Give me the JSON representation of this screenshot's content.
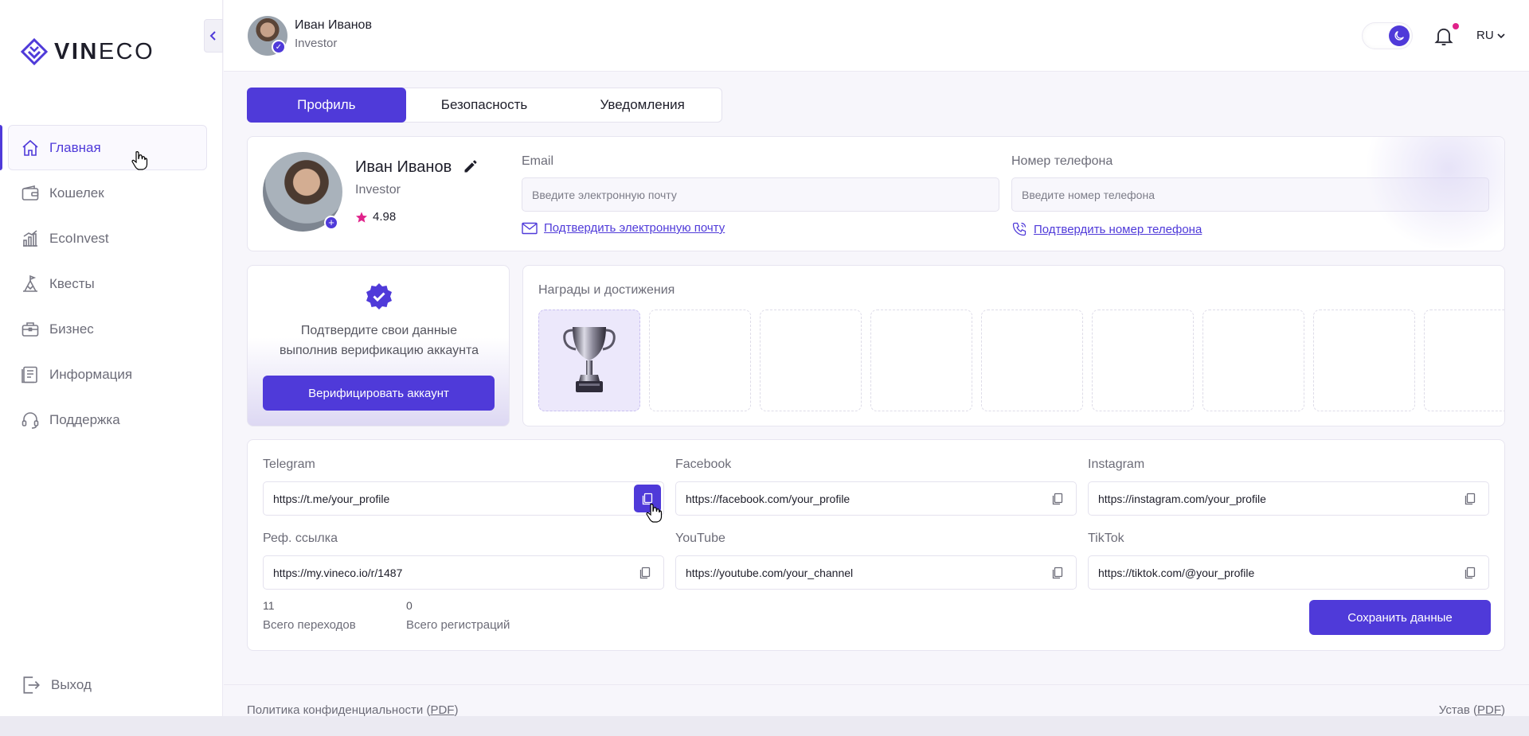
{
  "brand": {
    "logo_bold": "VIN",
    "logo_light": "ECO",
    "accent": "#4f3ad9"
  },
  "sidebar": {
    "items": [
      {
        "label": "Главная",
        "icon": "home-icon",
        "active": true
      },
      {
        "label": "Кошелек",
        "icon": "wallet-icon"
      },
      {
        "label": "EcoInvest",
        "icon": "chart-icon"
      },
      {
        "label": "Квесты",
        "icon": "quest-icon"
      },
      {
        "label": "Бизнес",
        "icon": "briefcase-icon"
      },
      {
        "label": "Информация",
        "icon": "document-icon"
      },
      {
        "label": "Поддержка",
        "icon": "headset-icon"
      }
    ],
    "logout": "Выход"
  },
  "header": {
    "user_name": "Иван Иванов",
    "user_role": "Investor",
    "lang": "RU"
  },
  "tabs": [
    "Профиль",
    "Безопасность",
    "Уведомления"
  ],
  "profile": {
    "name": "Иван Иванов",
    "role": "Investor",
    "rating": "4.98",
    "email_label": "Email",
    "email_placeholder": "Введите электронную почту",
    "email_verify": "Подтвердить электронную почту",
    "phone_label": "Номер телефона",
    "phone_placeholder": "Введите номер телефона",
    "phone_verify": "Подтвердить номер телефона"
  },
  "verify": {
    "line1": "Подтвердите свои данные",
    "line2": "выполнив верификацию аккаунта",
    "button": "Верифицировать аккаунт"
  },
  "awards": {
    "title": "Награды и достижения"
  },
  "social": {
    "telegram_label": "Telegram",
    "telegram": "https://t.me/your_profile",
    "facebook_label": "Facebook",
    "facebook": "https://facebook.com/your_profile",
    "instagram_label": "Instagram",
    "instagram": "https://instagram.com/your_profile",
    "ref_label": "Реф. ссылка",
    "ref": "https://my.vineco.io/r/1487",
    "youtube_label": "YouTube",
    "youtube": "https://youtube.com/your_channel",
    "tiktok_label": "TikTok",
    "tiktok": "https://tiktok.com/@your_profile",
    "visits": "11",
    "visits_label": "Всего переходов",
    "regs": "0",
    "regs_label": "Всего регистраций",
    "save": "Сохранить данные"
  },
  "footer": {
    "privacy": "Политика конфиденциальности (",
    "charter": "Устав (",
    "pdf": "PDF",
    "close": ")"
  }
}
